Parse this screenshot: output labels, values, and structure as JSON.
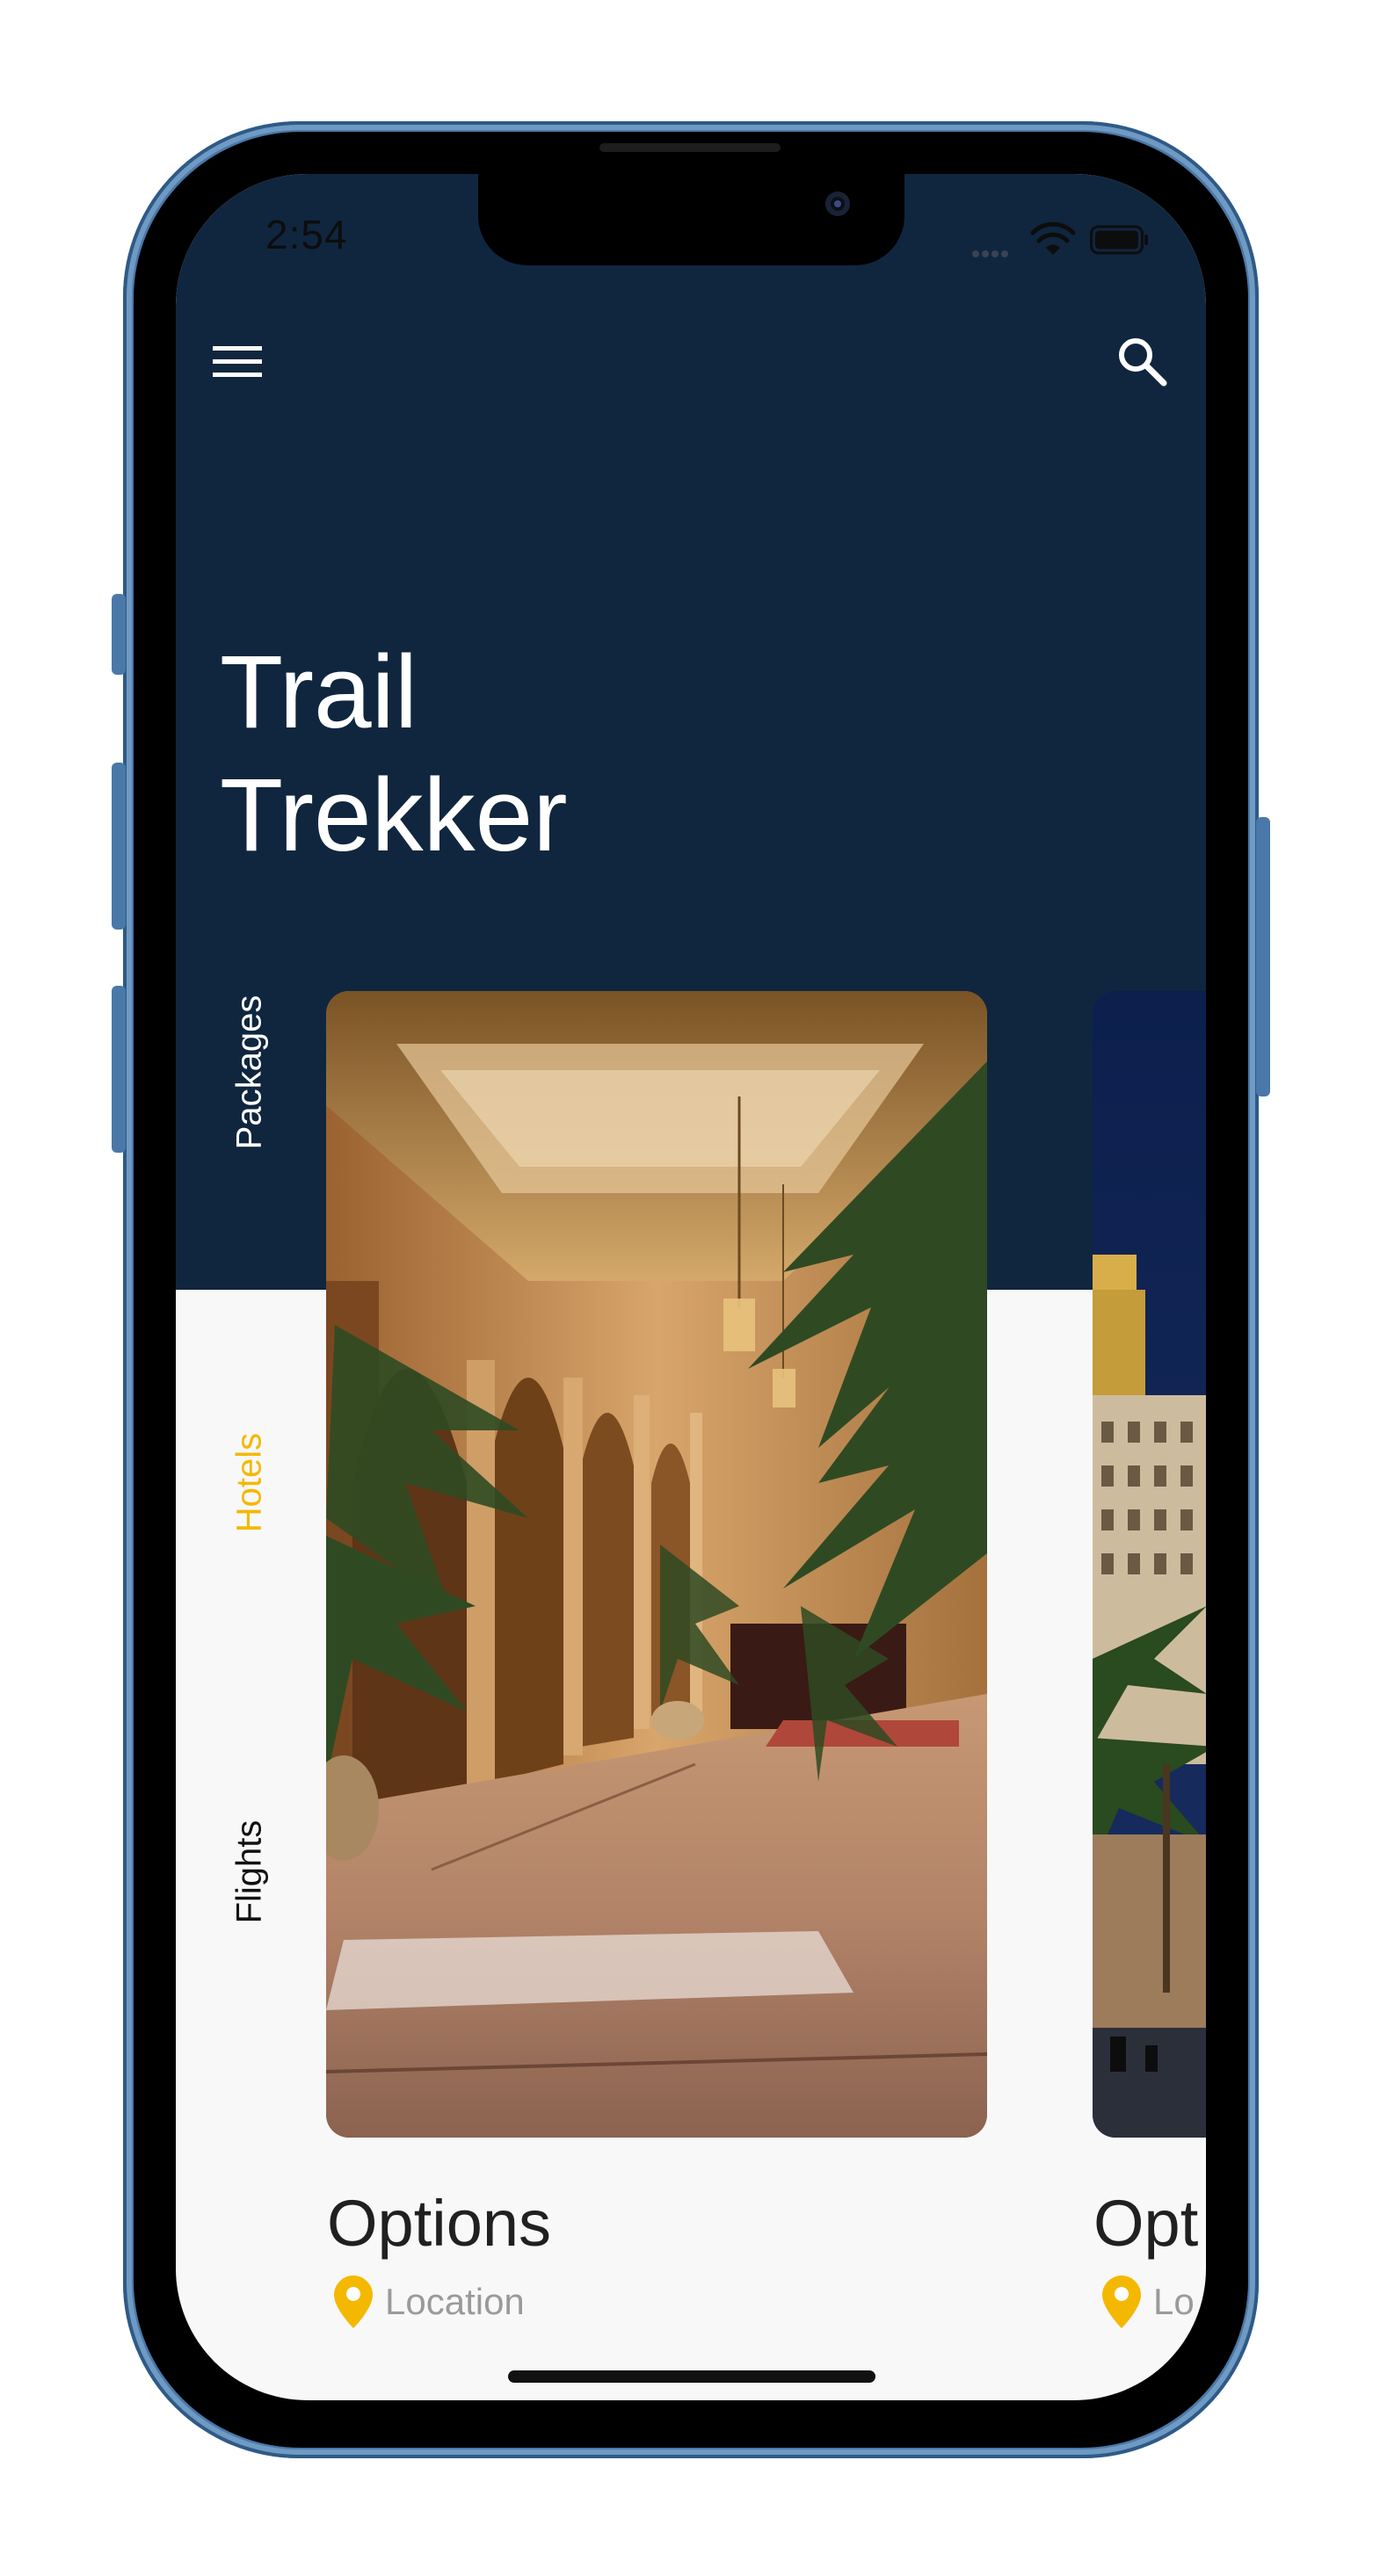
{
  "status_bar": {
    "time": "2:54"
  },
  "header": {
    "menu_icon": "menu-icon",
    "search_icon": "search-icon"
  },
  "hero": {
    "title_line1": "Trail",
    "title_line2": "Trekker"
  },
  "side_nav": {
    "tabs": [
      {
        "label": "Packages",
        "active": false
      },
      {
        "label": "Hotels",
        "active": true
      },
      {
        "label": "Flights",
        "active": false
      }
    ],
    "active_color": "#f5b800"
  },
  "cards": [
    {
      "title": "Options",
      "location": "Location",
      "image": "palace-lobby-photo"
    },
    {
      "title": "Opt",
      "location": "Lo",
      "image": "hotel-night-photo"
    }
  ],
  "colors": {
    "hero_background": "#10263f",
    "page_background": "#f8f8f9",
    "accent": "#f5b800",
    "phone_frame": "#4a78a8"
  }
}
